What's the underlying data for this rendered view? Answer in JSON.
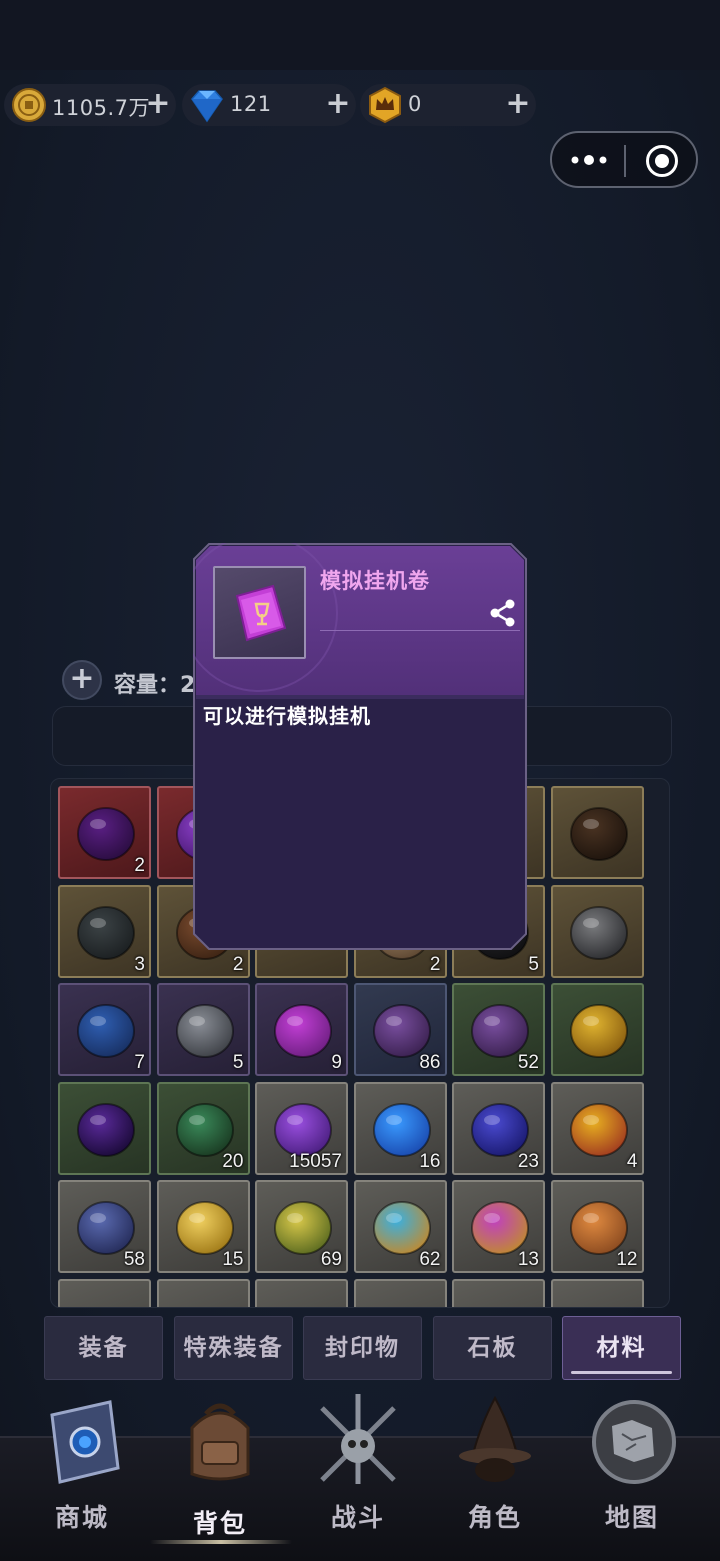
{
  "currencies": [
    {
      "name": "coin",
      "value": "1105.7万",
      "icon": "coin-icon",
      "color": "#d9a93a"
    },
    {
      "name": "diamond",
      "value": "121",
      "icon": "diamond-icon",
      "color": "#2f7fe0"
    },
    {
      "name": "crown",
      "value": "0",
      "icon": "crown-badge-icon",
      "color": "#e2a526"
    }
  ],
  "currency_plus": "+",
  "capacity": {
    "label": "容量：2",
    "plus": "+"
  },
  "popup": {
    "item_name": "模拟挂机卷",
    "description": "可以进行模拟挂机",
    "icon": "purple-scroll-icon",
    "share_icon": "share-icon"
  },
  "inventory": [
    {
      "icon": "purple-orb",
      "rarity": "r",
      "qty": "2"
    },
    {
      "icon": "purple-crystal",
      "rarity": "r",
      "qty": ""
    },
    {
      "icon": "hidden",
      "rarity": "y",
      "qty": ""
    },
    {
      "icon": "hidden",
      "rarity": "y",
      "qty": ""
    },
    {
      "icon": "hidden",
      "rarity": "y",
      "qty": ""
    },
    {
      "icon": "dark-cube",
      "rarity": "y",
      "qty": ""
    },
    {
      "icon": "rough-ore",
      "rarity": "y",
      "qty": "3"
    },
    {
      "icon": "wood-log",
      "rarity": "y",
      "qty": "2"
    },
    {
      "icon": "hidden",
      "rarity": "y",
      "qty": ""
    },
    {
      "icon": "scroll",
      "rarity": "y",
      "qty": "2"
    },
    {
      "icon": "black-ring",
      "rarity": "y",
      "qty": "5"
    },
    {
      "icon": "stone-ring",
      "rarity": "y",
      "qty": ""
    },
    {
      "icon": "blue-puzzle",
      "rarity": "p",
      "qty": "7"
    },
    {
      "icon": "metal-pipe",
      "rarity": "p",
      "qty": "5"
    },
    {
      "icon": "purple-scroll",
      "rarity": "p",
      "qty": "9"
    },
    {
      "icon": "purple-thorn-orb",
      "rarity": "b",
      "qty": "86"
    },
    {
      "icon": "purple-thorn-orb",
      "rarity": "g",
      "qty": "52"
    },
    {
      "icon": "amber-gem",
      "rarity": "g",
      "qty": ""
    },
    {
      "icon": "dark-crystal",
      "rarity": "g",
      "qty": ""
    },
    {
      "icon": "green-jade",
      "rarity": "g",
      "qty": "20"
    },
    {
      "icon": "violet-shard",
      "rarity": "w",
      "qty": "15057"
    },
    {
      "icon": "blue-diamond",
      "rarity": "w",
      "qty": "16"
    },
    {
      "icon": "blue-pearl",
      "rarity": "w",
      "qty": "23"
    },
    {
      "icon": "gold-cube",
      "rarity": "w",
      "qty": "4"
    },
    {
      "icon": "blue-rock",
      "rarity": "w",
      "qty": "58"
    },
    {
      "icon": "gold-crystal",
      "rarity": "w",
      "qty": "15"
    },
    {
      "icon": "yellow-orb",
      "rarity": "w",
      "qty": "69"
    },
    {
      "icon": "blue-orb",
      "rarity": "w",
      "qty": "62"
    },
    {
      "icon": "magenta-orb",
      "rarity": "w",
      "qty": "13"
    },
    {
      "icon": "orange-orb",
      "rarity": "w",
      "qty": "12"
    },
    {
      "icon": "partial",
      "rarity": "w",
      "qty": ""
    },
    {
      "icon": "partial",
      "rarity": "w",
      "qty": ""
    },
    {
      "icon": "partial",
      "rarity": "w",
      "qty": ""
    },
    {
      "icon": "partial",
      "rarity": "w",
      "qty": ""
    },
    {
      "icon": "partial",
      "rarity": "w",
      "qty": ""
    },
    {
      "icon": "partial",
      "rarity": "w",
      "qty": ""
    }
  ],
  "tabs": [
    {
      "label": "装备",
      "active": false
    },
    {
      "label": "特殊装备",
      "active": false
    },
    {
      "label": "封印物",
      "active": false
    },
    {
      "label": "石板",
      "active": false
    },
    {
      "label": "材料",
      "active": true
    }
  ],
  "nav": [
    {
      "label": "商城",
      "icon": "spellbook-icon",
      "active": false
    },
    {
      "label": "背包",
      "icon": "backpack-icon",
      "active": true
    },
    {
      "label": "战斗",
      "icon": "skull-swords-icon",
      "active": false
    },
    {
      "label": "角色",
      "icon": "wizard-hat-icon",
      "active": false
    },
    {
      "label": "地图",
      "icon": "map-icon",
      "active": false
    }
  ]
}
